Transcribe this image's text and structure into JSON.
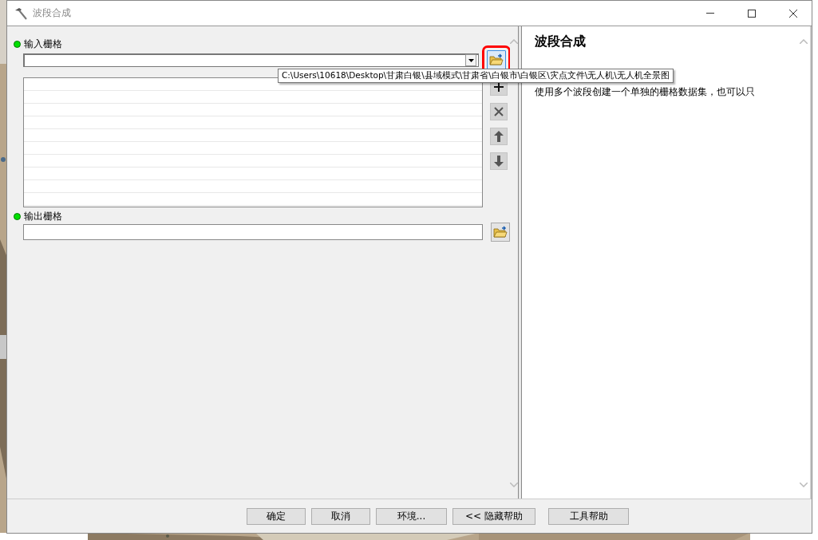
{
  "window": {
    "title": "波段合成"
  },
  "input_raster": {
    "label": "输入栅格",
    "browse_highlighted": true,
    "list_buttons": [
      {
        "kind": "add"
      },
      {
        "kind": "remove"
      },
      {
        "kind": "up"
      },
      {
        "kind": "down"
      }
    ]
  },
  "tooltip": "C:\\Users\\10618\\Desktop\\甘肃白银\\县域模式\\甘肃省\\白银市\\白银区\\灾点文件\\无人机\\无人机全景图",
  "output_raster": {
    "label": "输出栅格",
    "browse_highlighted": false
  },
  "help": {
    "title": "波段合成",
    "text": "使用多个波段创建一个单独的栅格数据集，也可以只"
  },
  "buttons": [
    {
      "label": "确定"
    },
    {
      "label": "取消"
    },
    {
      "label": "环境..."
    },
    {
      "label": "<< 隐藏帮助"
    },
    {
      "label": "工具帮助"
    }
  ]
}
